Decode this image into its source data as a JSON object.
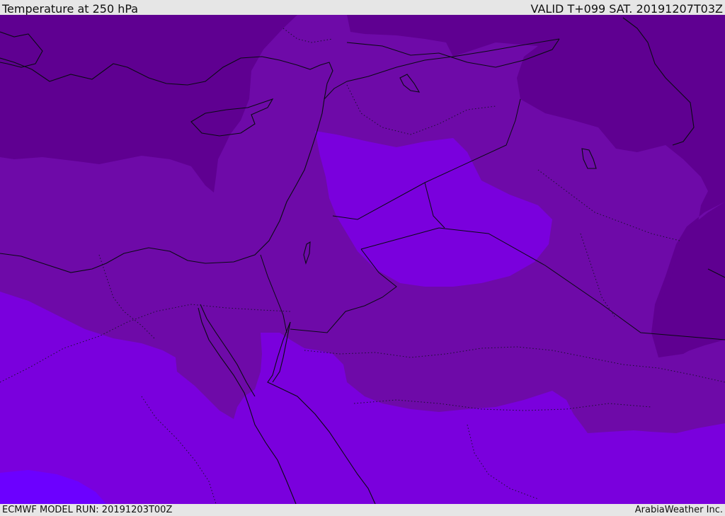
{
  "header": {
    "title": "Temperature at 250 hPa",
    "valid": "VALID T+099 SAT. 20191207T03Z"
  },
  "footer": {
    "model_run": "ECMWF MODEL RUN: 20191203T00Z",
    "credit": "ArabiaWeather Inc."
  },
  "map": {
    "parameter": "temperature",
    "level": "250 hPa",
    "band_colors": [
      "#5f0091",
      "#6e0aa8",
      "#7a00dd",
      "#6c00ff"
    ]
  }
}
